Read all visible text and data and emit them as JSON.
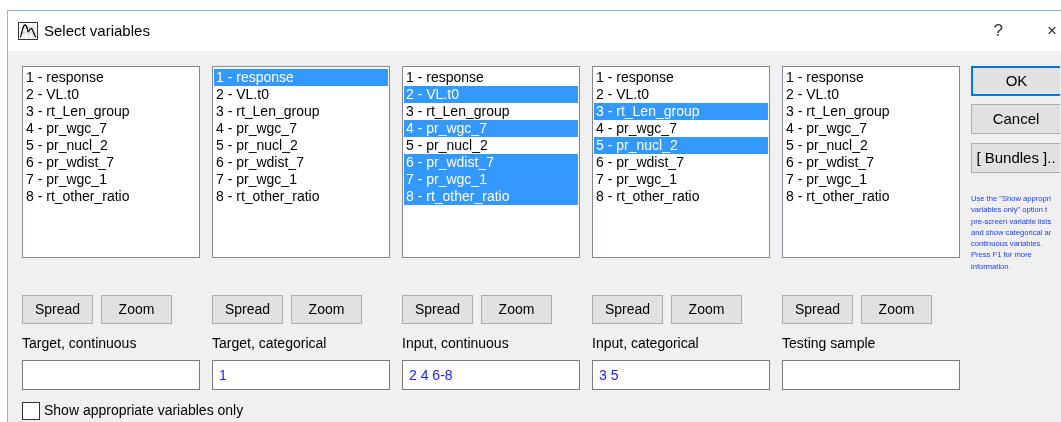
{
  "window": {
    "title": "Select variables",
    "help_button": "?",
    "close_button": "×"
  },
  "panels": [
    {
      "items": [
        {
          "label": "1 - response",
          "selected": false
        },
        {
          "label": "2 - VL.t0",
          "selected": false
        },
        {
          "label": "3 - rt_Len_group",
          "selected": false
        },
        {
          "label": "4 - pr_wgc_7",
          "selected": false
        },
        {
          "label": "5 - pr_nucl_2",
          "selected": false
        },
        {
          "label": "6 - pr_wdist_7",
          "selected": false
        },
        {
          "label": "7 - pr_wgc_1",
          "selected": false
        },
        {
          "label": "8 - rt_other_ratio",
          "selected": false
        }
      ],
      "buttons": [
        "Spread",
        "Zoom"
      ],
      "label": "Target, continuous"
    },
    {
      "items": [
        {
          "label": "1 - response",
          "selected": true
        },
        {
          "label": "2 - VL.t0",
          "selected": false
        },
        {
          "label": "3 - rt_Len_group",
          "selected": false
        },
        {
          "label": "4 - pr_wgc_7",
          "selected": false
        },
        {
          "label": "5 - pr_nucl_2",
          "selected": false
        },
        {
          "label": "6 - pr_wdist_7",
          "selected": false
        },
        {
          "label": "7 - pr_wgc_1",
          "selected": false
        },
        {
          "label": "8 - rt_other_ratio",
          "selected": false
        }
      ],
      "buttons": [
        "Spread",
        "Zoom"
      ],
      "label": "Target, categorical",
      "value": "1"
    },
    {
      "items": [
        {
          "label": "1 - response",
          "selected": false
        },
        {
          "label": "2 - VL.t0",
          "selected": true
        },
        {
          "label": "3 - rt_Len_group",
          "selected": false
        },
        {
          "label": "4 - pr_wgc_7",
          "selected": true
        },
        {
          "label": "5 - pr_nucl_2",
          "selected": false
        },
        {
          "label": "6 - pr_wdist_7",
          "selected": true
        },
        {
          "label": "7 - pr_wgc_1",
          "selected": true
        },
        {
          "label": "8 - rt_other_ratio",
          "selected": true
        }
      ],
      "buttons": [
        "Spread",
        "Zoom"
      ],
      "label": "Input, continuous",
      "value": "2 4 6-8"
    },
    {
      "items": [
        {
          "label": "1 - response",
          "selected": false
        },
        {
          "label": "2 - VL.t0",
          "selected": false
        },
        {
          "label": "3 - rt_Len_group",
          "selected": true
        },
        {
          "label": "4 - pr_wgc_7",
          "selected": false
        },
        {
          "label": "5 - pr_nucl_2",
          "selected": true
        },
        {
          "label": "6 - pr_wdist_7",
          "selected": false
        },
        {
          "label": "7 - pr_wgc_1",
          "selected": false
        },
        {
          "label": "8 - rt_other_ratio",
          "selected": false
        }
      ],
      "buttons": [
        "Spread",
        "Zoom"
      ],
      "label": "Input, categorical",
      "value": "3 5"
    },
    {
      "items": [
        {
          "label": "1 - response",
          "selected": false
        },
        {
          "label": "2 - VL.t0",
          "selected": false
        },
        {
          "label": "3 - rt_Len_group",
          "selected": false
        },
        {
          "label": "4 - pr_wgc_7",
          "selected": false
        },
        {
          "label": "5 - pr_nucl_2",
          "selected": false
        },
        {
          "label": "6 - pr_wdist_7",
          "selected": false
        },
        {
          "label": "7 - pr_wgc_1",
          "selected": false
        },
        {
          "label": "8 - rt_other_ratio",
          "selected": false
        }
      ],
      "buttons": [
        "Spread",
        "Zoom"
      ],
      "label": "Testing sample"
    }
  ],
  "side_buttons": [
    {
      "label": "OK",
      "default": true
    },
    {
      "label": "Cancel",
      "default": false
    },
    {
      "label": "[ Bundles ]..",
      "default": false
    }
  ],
  "help_text": [
    "Use the \"Show appropri",
    "variables only\" option t",
    "pre-screen variable lists",
    "and show categorical ar",
    "continuous variables.",
    "Press F1 for more",
    "information."
  ],
  "show_appropriate": {
    "label": "Show appropriate variables only",
    "checked": false
  }
}
